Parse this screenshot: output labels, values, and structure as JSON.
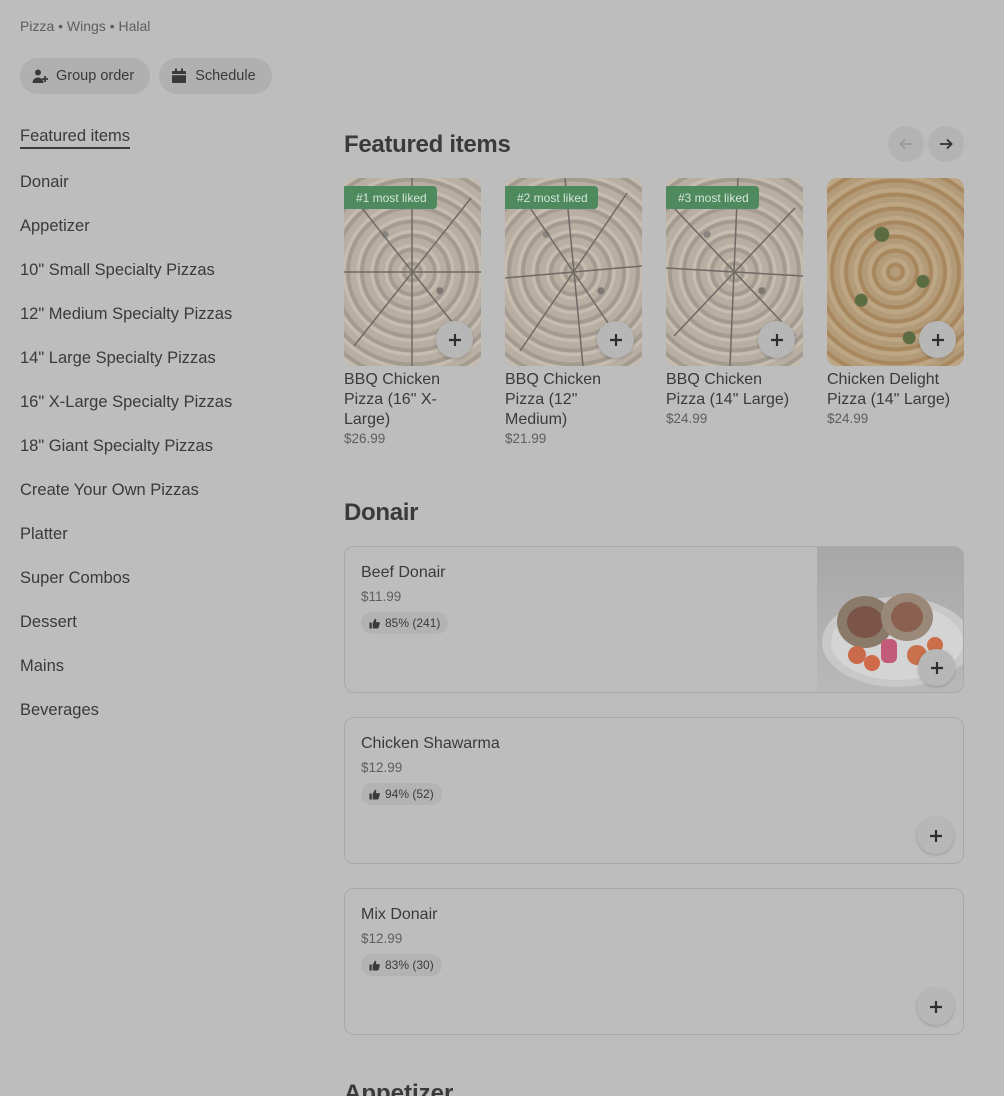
{
  "store": {
    "tags": "Pizza • Wings • Halal"
  },
  "actions": {
    "group_order": "Group order",
    "schedule": "Schedule"
  },
  "sidebar": {
    "items": [
      {
        "label": "Featured items"
      },
      {
        "label": "Donair"
      },
      {
        "label": "Appetizer"
      },
      {
        "label": "10\" Small Specialty Pizzas"
      },
      {
        "label": "12\" Medium Specialty Pizzas"
      },
      {
        "label": "14\" Large Specialty Pizzas"
      },
      {
        "label": "16\" X-Large Specialty Pizzas"
      },
      {
        "label": "18\" Giant Specialty Pizzas"
      },
      {
        "label": "Create Your Own Pizzas"
      },
      {
        "label": "Platter"
      },
      {
        "label": "Super Combos"
      },
      {
        "label": "Dessert"
      },
      {
        "label": "Mains"
      },
      {
        "label": "Beverages"
      }
    ]
  },
  "featured": {
    "title": "Featured items",
    "items": [
      {
        "badge": "#1 most liked",
        "name": "BBQ Chicken Pizza (16\" X-Large)",
        "price": "$26.99"
      },
      {
        "badge": "#2 most liked",
        "name": "BBQ Chicken Pizza (12\" Medium)",
        "price": "$21.99"
      },
      {
        "badge": "#3 most liked",
        "name": "BBQ Chicken Pizza (14\" Large)",
        "price": "$24.99"
      },
      {
        "badge": "",
        "name": "Chicken Delight Pizza (14\" Large)",
        "price": "$24.99"
      }
    ]
  },
  "donair": {
    "title": "Donair",
    "items": [
      {
        "name": "Beef Donair",
        "price": "$11.99",
        "rating": "85% (241)"
      },
      {
        "name": "Chicken Shawarma",
        "price": "$12.99",
        "rating": "94% (52)"
      },
      {
        "name": "Mix Donair",
        "price": "$12.99",
        "rating": "83% (30)"
      }
    ]
  },
  "next_section": {
    "title": "Appetizer"
  },
  "colors": {
    "badge_bg": "#4e8a5e",
    "overlay_bg": "#bdbdbd"
  },
  "icons": [
    "group-order-icon",
    "calendar-icon",
    "arrow-left-icon",
    "arrow-right-icon",
    "plus-icon",
    "thumbs-up-icon"
  ]
}
